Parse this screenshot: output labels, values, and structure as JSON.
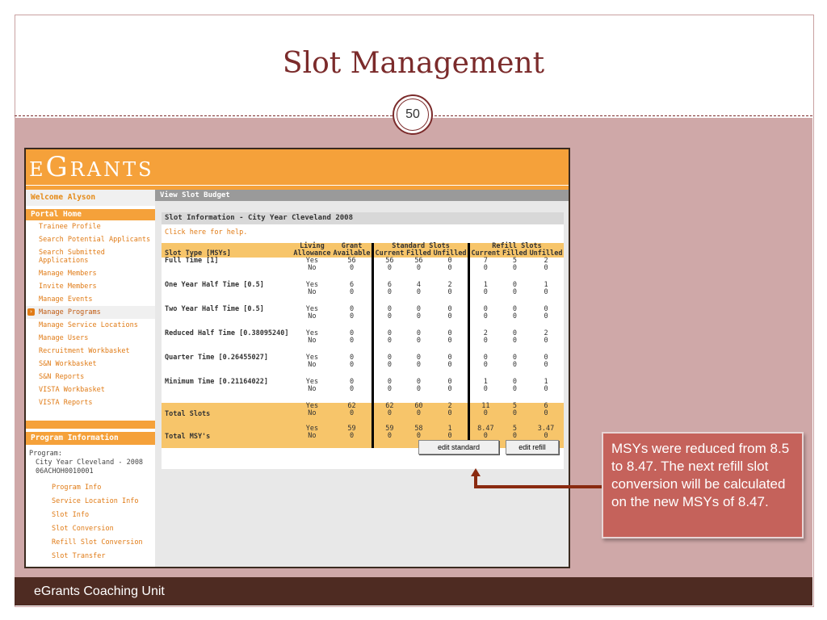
{
  "slide": {
    "title": "Slot Management",
    "page_number": "50",
    "footer": "eGrants Coaching Unit",
    "callout": "MSYs were reduced from 8.5 to 8.47. The next refill slot conversion will be calculated on the new MSYs of 8.47."
  },
  "app": {
    "logo": "eGrants",
    "sidebar": {
      "welcome": "Welcome Alyson",
      "portal_home": "Portal Home",
      "items": [
        "Trainee Profile",
        "Search Potential Applicants",
        "Search Submitted Applications",
        "Manage Members",
        "Invite Members",
        "Manage Events",
        "Manage Programs",
        "Manage Service Locations",
        "Manage Users",
        "Recruitment Workbasket",
        "S&N Workbasket",
        "S&N Reports",
        "VISTA Workbasket",
        "VISTA Reports"
      ],
      "active_item": "Manage Programs",
      "program_info_head": "Program Information",
      "program_label": "Program:",
      "program_name": "City Year Cleveland - 2008",
      "program_id": "06ACHOH0010001",
      "sub_items": [
        "Program Info",
        "Service Location Info",
        "Slot Info",
        "Slot Conversion",
        "Refill Slot Conversion",
        "Slot Transfer"
      ]
    },
    "main": {
      "title": "View Slot Budget",
      "panel_title": "Slot Information - City Year Cleveland 2008",
      "help_link": "Click here for help.",
      "headers": {
        "living_top": "Living",
        "grant_top": "Grant",
        "standard_top": "Standard Slots",
        "refill_top": "Refill Slots",
        "slot_type": "Slot Type [MSYs]",
        "allowance": "Allowance",
        "available": "Available",
        "current": "Current",
        "filled": "Filled",
        "unfilled": "Unfilled"
      },
      "rows": [
        {
          "label": "Full Time [1]",
          "la": [
            "Yes",
            "No"
          ],
          "grant": [
            "56",
            "0"
          ],
          "std_cur": [
            "56",
            "0"
          ],
          "std_fill": [
            "56",
            "0"
          ],
          "std_unf": [
            "0",
            "0"
          ],
          "ref_cur": [
            "7",
            "0"
          ],
          "ref_fill": [
            "5",
            "0"
          ],
          "ref_unf": [
            "2",
            "0"
          ]
        },
        {
          "label": "One Year Half Time [0.5]",
          "la": [
            "Yes",
            "No"
          ],
          "grant": [
            "6",
            "0"
          ],
          "std_cur": [
            "6",
            "0"
          ],
          "std_fill": [
            "4",
            "0"
          ],
          "std_unf": [
            "2",
            "0"
          ],
          "ref_cur": [
            "1",
            "0"
          ],
          "ref_fill": [
            "0",
            "0"
          ],
          "ref_unf": [
            "1",
            "0"
          ]
        },
        {
          "label": "Two Year Half Time [0.5]",
          "la": [
            "Yes",
            "No"
          ],
          "grant": [
            "0",
            "0"
          ],
          "std_cur": [
            "0",
            "0"
          ],
          "std_fill": [
            "0",
            "0"
          ],
          "std_unf": [
            "0",
            "0"
          ],
          "ref_cur": [
            "0",
            "0"
          ],
          "ref_fill": [
            "0",
            "0"
          ],
          "ref_unf": [
            "0",
            "0"
          ]
        },
        {
          "label": "Reduced Half Time [0.38095240]",
          "la": [
            "Yes",
            "No"
          ],
          "grant": [
            "0",
            "0"
          ],
          "std_cur": [
            "0",
            "0"
          ],
          "std_fill": [
            "0",
            "0"
          ],
          "std_unf": [
            "0",
            "0"
          ],
          "ref_cur": [
            "2",
            "0"
          ],
          "ref_fill": [
            "0",
            "0"
          ],
          "ref_unf": [
            "2",
            "0"
          ]
        },
        {
          "label": "Quarter Time [0.26455027]",
          "la": [
            "Yes",
            "No"
          ],
          "grant": [
            "0",
            "0"
          ],
          "std_cur": [
            "0",
            "0"
          ],
          "std_fill": [
            "0",
            "0"
          ],
          "std_unf": [
            "0",
            "0"
          ],
          "ref_cur": [
            "0",
            "0"
          ],
          "ref_fill": [
            "0",
            "0"
          ],
          "ref_unf": [
            "0",
            "0"
          ]
        },
        {
          "label": "Minimum Time [0.21164022]",
          "la": [
            "Yes",
            "No"
          ],
          "grant": [
            "0",
            "0"
          ],
          "std_cur": [
            "0",
            "0"
          ],
          "std_fill": [
            "0",
            "0"
          ],
          "std_unf": [
            "0",
            "0"
          ],
          "ref_cur": [
            "1",
            "0"
          ],
          "ref_fill": [
            "0",
            "0"
          ],
          "ref_unf": [
            "1",
            "0"
          ]
        }
      ],
      "totals": [
        {
          "label": "Total Slots",
          "la": [
            "Yes",
            "No"
          ],
          "grant": [
            "62",
            "0"
          ],
          "std_cur": [
            "62",
            "0"
          ],
          "std_fill": [
            "60",
            "0"
          ],
          "std_unf": [
            "2",
            "0"
          ],
          "ref_cur": [
            "11",
            "0"
          ],
          "ref_fill": [
            "5",
            "0"
          ],
          "ref_unf": [
            "6",
            "0"
          ]
        },
        {
          "label": "Total MSY's",
          "la": [
            "Yes",
            "No"
          ],
          "grant": [
            "59",
            "0"
          ],
          "std_cur": [
            "59",
            "0"
          ],
          "std_fill": [
            "58",
            "0"
          ],
          "std_unf": [
            "1",
            "0"
          ],
          "ref_cur": [
            "8.47",
            "0"
          ],
          "ref_fill": [
            "5",
            "0"
          ],
          "ref_unf": [
            "3.47",
            "0"
          ]
        }
      ],
      "edit_standard": "edit standard",
      "edit_refill": "edit refill"
    }
  }
}
